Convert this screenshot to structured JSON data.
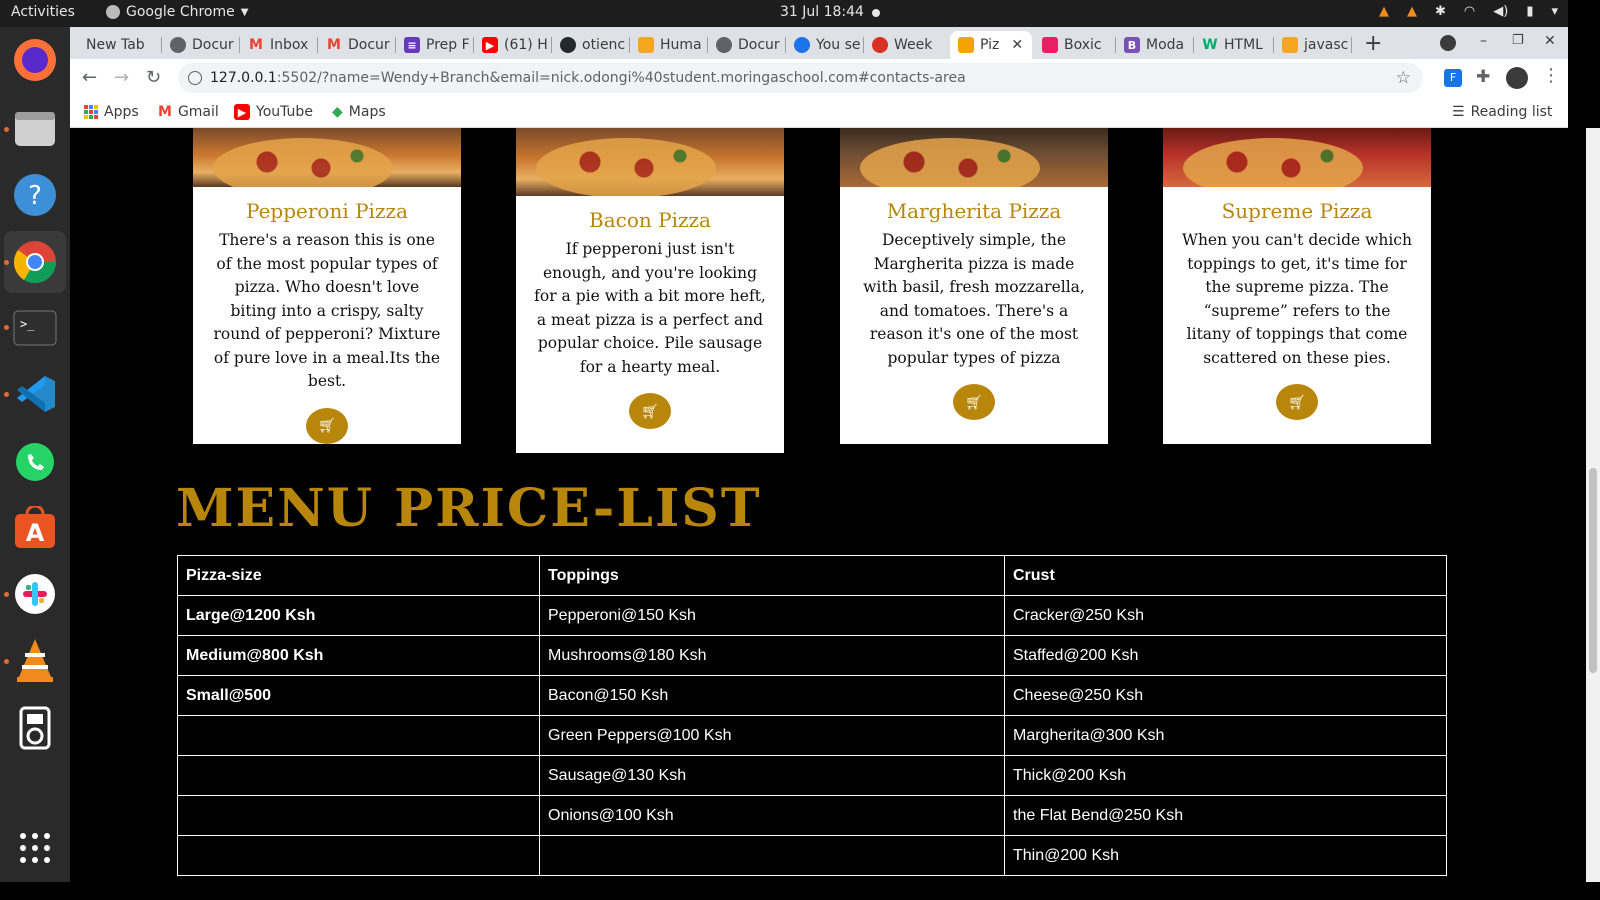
{
  "system": {
    "activities": "Activities",
    "app_name": "Google Chrome",
    "clock": "31 Jul  18:44"
  },
  "browser": {
    "tabs": [
      {
        "label": "New Tab",
        "icon": "none"
      },
      {
        "label": "Docur",
        "icon": "docs-icon"
      },
      {
        "label": "Inbox",
        "icon": "gmail-icon"
      },
      {
        "label": "Docur",
        "icon": "gmail-icon"
      },
      {
        "label": "Prep F",
        "icon": "forms-icon"
      },
      {
        "label": "(61) H",
        "icon": "youtube-icon"
      },
      {
        "label": "otienc",
        "icon": "github-icon"
      },
      {
        "label": "Huma",
        "icon": "page-icon"
      },
      {
        "label": "Docur",
        "icon": "docs-icon"
      },
      {
        "label": "You se",
        "icon": "page-icon"
      },
      {
        "label": "Week",
        "icon": "page-icon"
      },
      {
        "label": "Piz",
        "icon": "pizza-icon"
      },
      {
        "label": "Boxic",
        "icon": "boxicons-icon"
      },
      {
        "label": "Moda",
        "icon": "bootstrap-icon"
      },
      {
        "label": "HTML",
        "icon": "w3-icon"
      },
      {
        "label": "javasc",
        "icon": "page-icon"
      }
    ],
    "url_host": "127.0.0.1",
    "url_rest": ":5502/?name=Wendy+Branch&email=nick.odongi%40student.moringaschool.com#contacts-area",
    "bookmarks": [
      "Apps",
      "Gmail",
      "YouTube",
      "Maps"
    ],
    "reading_list": "Reading list"
  },
  "pizzas": [
    {
      "name": "Pepperoni Pizza",
      "desc": "There's a reason this is one of the most popular types of pizza. Who doesn't love biting into a crispy, salty round of pepperoni? Mixture of pure love in a meal.Its the best."
    },
    {
      "name": "Bacon Pizza",
      "desc": "If pepperoni just isn't enough, and you're looking for a pie with a bit more heft, a meat pizza is a perfect and popular choice. Pile sausage for a hearty meal."
    },
    {
      "name": "Margherita Pizza",
      "desc": "Deceptively simple, the Margherita pizza is made with basil, fresh mozzarella, and tomatoes. There's a reason it's one of the most popular types of pizza"
    },
    {
      "name": "Supreme Pizza",
      "desc": "When you can't decide which toppings to get, it's time for the supreme pizza. The “supreme” refers to the litany of toppings that come scattered on these pies."
    }
  ],
  "menu": {
    "title": "MENU PRICE-LIST",
    "headers": [
      "Pizza-size",
      "Toppings",
      "Crust"
    ],
    "rows": [
      [
        "Large@1200 Ksh",
        "Pepperoni@150 Ksh",
        "Cracker@250 Ksh"
      ],
      [
        "Medium@800 Ksh",
        "Mushrooms@180 Ksh",
        "Staffed@200 Ksh"
      ],
      [
        "Small@500",
        "Bacon@150 Ksh",
        "Cheese@250 Ksh"
      ],
      [
        "",
        "Green Peppers@100 Ksh",
        "Margherita@300 Ksh"
      ],
      [
        "",
        "Sausage@130 Ksh",
        "Thick@200 Ksh"
      ],
      [
        "",
        "Onions@100 Ksh",
        "the Flat Bend@250 Ksh"
      ],
      [
        "",
        "",
        "Thin@200 Ksh"
      ]
    ]
  },
  "colors": {
    "accent_gold": "#b8860b",
    "page_bg": "#000000"
  }
}
